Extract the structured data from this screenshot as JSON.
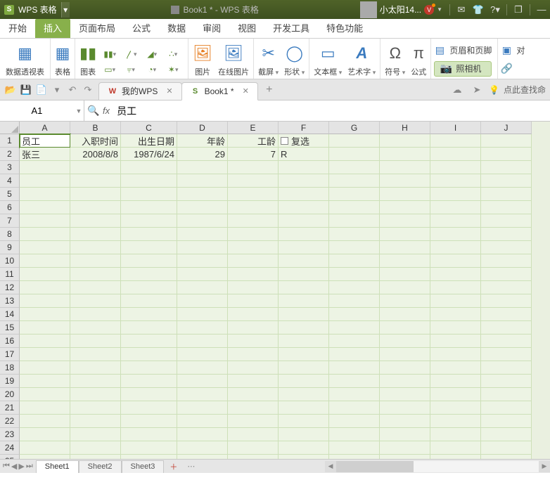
{
  "titlebar": {
    "app": "WPS 表格",
    "doc": "Book1 * - WPS 表格",
    "user": "小太阳14...",
    "vbadge": "V"
  },
  "menu": {
    "tabs": [
      "开始",
      "插入",
      "页面布局",
      "公式",
      "数据",
      "审阅",
      "视图",
      "开发工具",
      "特色功能"
    ],
    "active": 1
  },
  "ribbon": {
    "pivot": "数据透视表",
    "table": "表格",
    "chart": "图表",
    "image": "图片",
    "online_image": "在线图片",
    "screenshot": "截屏",
    "shape": "形状",
    "textbox": "文本框",
    "wordart": "艺术字",
    "symbol": "符号",
    "equation": "公式",
    "header_footer": "页眉和页脚",
    "object": "对",
    "hyperlink": "照相机"
  },
  "doctabs": {
    "mywps": "我的WPS",
    "book": "Book1 *",
    "search": "点此查找命"
  },
  "namebox": {
    "ref": "A1"
  },
  "formula_bar": {
    "value": "员工"
  },
  "grid": {
    "cols": [
      {
        "l": "A",
        "w": 72
      },
      {
        "l": "B",
        "w": 72
      },
      {
        "l": "C",
        "w": 80
      },
      {
        "l": "D",
        "w": 72
      },
      {
        "l": "E",
        "w": 72
      },
      {
        "l": "F",
        "w": 72
      },
      {
        "l": "G",
        "w": 72
      },
      {
        "l": "H",
        "w": 72
      },
      {
        "l": "I",
        "w": 72
      },
      {
        "l": "J",
        "w": 72
      }
    ],
    "rows": 26,
    "headers": {
      "A": "员工",
      "B": "入职时间",
      "C": "出生日期",
      "D": "年龄",
      "E": "工龄"
    },
    "data_row": {
      "A": "张三",
      "B": "2008/8/8",
      "C": "1987/6/24",
      "D": "29",
      "E": "7",
      "F": "R"
    },
    "checkbox_label": "复选",
    "selected": {
      "r": 1,
      "c": 0
    }
  },
  "sheets": {
    "tabs": [
      "Sheet1",
      "Sheet2",
      "Sheet3"
    ],
    "active": 0
  }
}
